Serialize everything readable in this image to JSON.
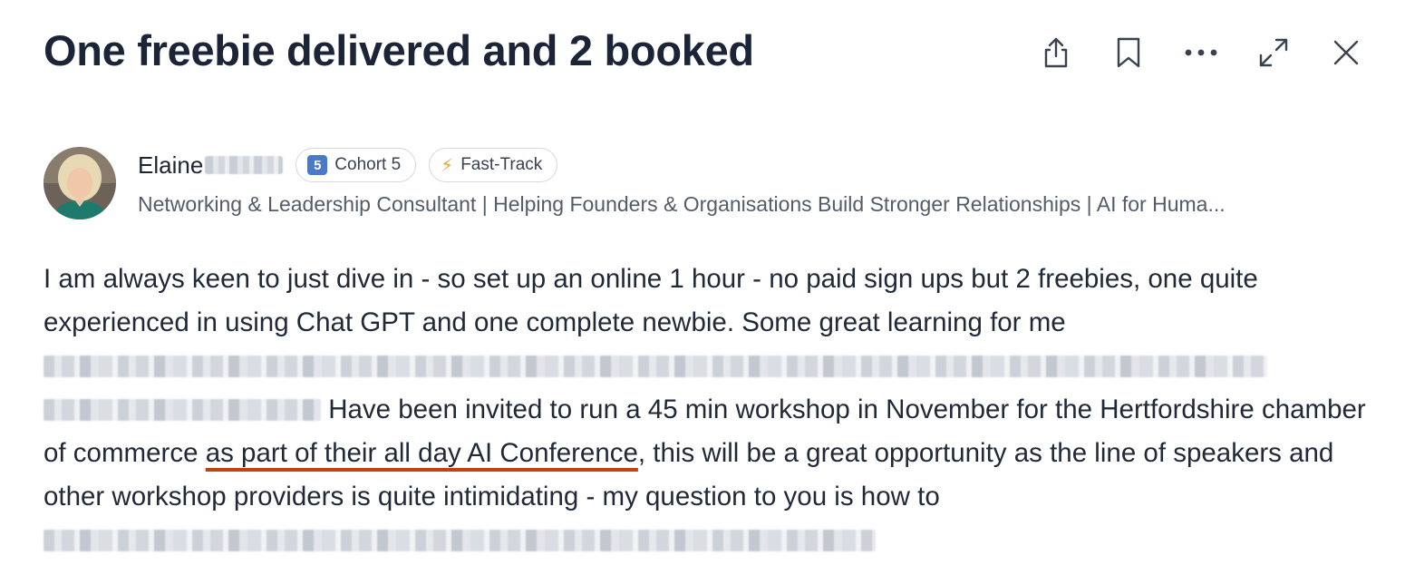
{
  "post": {
    "title": "One freebie delivered and 2 booked"
  },
  "actions": {
    "share_icon": "share-icon",
    "bookmark_icon": "bookmark-icon",
    "more_icon": "more-icon",
    "expand_icon": "expand-icon",
    "close_icon": "close-icon"
  },
  "author": {
    "name_visible": "Elaine",
    "badges": [
      {
        "number": "5",
        "label": "Cohort 5"
      },
      {
        "icon": "lightning-icon",
        "label": "Fast-Track"
      }
    ],
    "headline": "Networking & Leadership Consultant | Helping Founders & Organisations Build Stronger Relationships | AI for Huma..."
  },
  "body": {
    "text_1": "I am always keen to just dive in - so set up an online 1 hour - no paid sign ups but 2 freebies, one quite experienced in using Chat GPT and one complete newbie.  Some great learning for me",
    "text_2": "Have been invited to run a 45 min workshop in November for the Hertfordshire chamber of commerce",
    "highlight": "as part of their all day AI Conference",
    "text_3": ", this will be a great opportunity as the line of speakers and other workshop providers is quite intimidating - my question to you is how to"
  },
  "colors": {
    "title": "#1b2537",
    "underline_accent": "#c1440e",
    "badge_number_bg": "#4a79c8",
    "bolt": "#f2a13a"
  }
}
